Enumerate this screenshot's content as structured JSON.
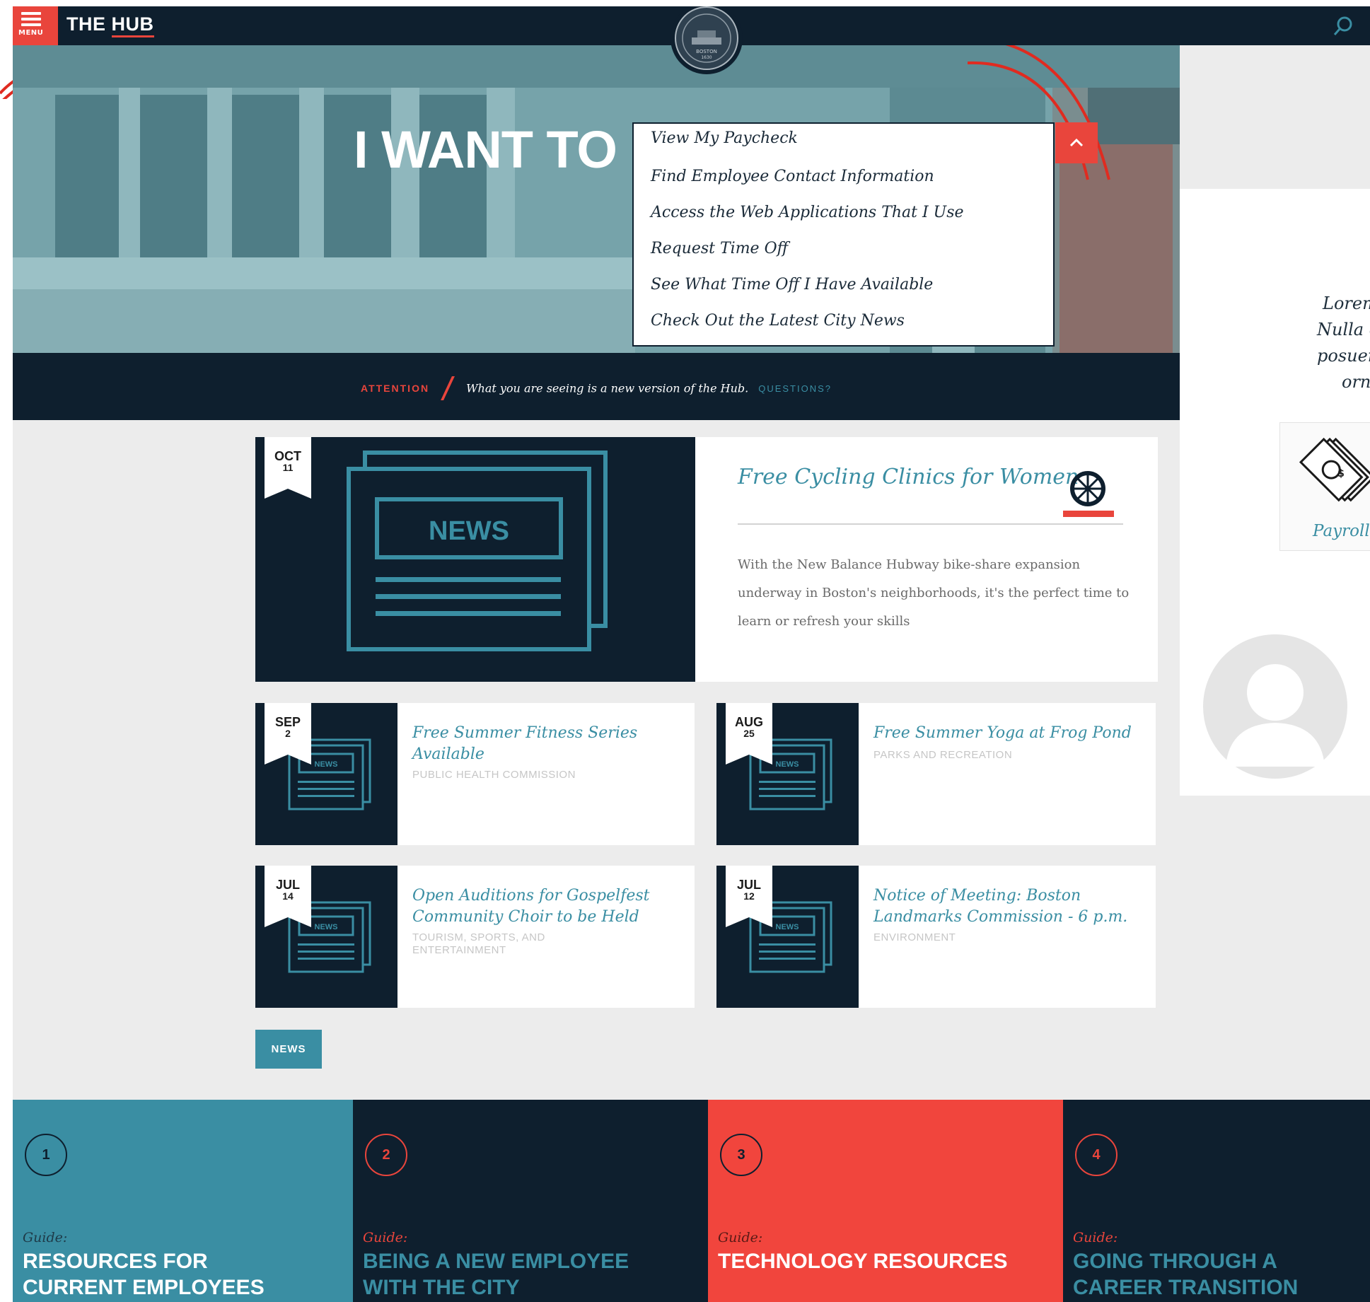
{
  "header": {
    "menu_label": "MENU",
    "site_title_a": "THE ",
    "site_title_b": "HUB",
    "seal_line1": "BOSTON",
    "seal_line2": "1630"
  },
  "hero": {
    "heading": "I WANT TO",
    "options": [
      "View My Paycheck",
      "Find Employee Contact Information",
      "Access the Web Applications That I Use",
      "Request Time Off",
      "See What Time Off I Have Available",
      "Check Out the Latest City News"
    ]
  },
  "attention": {
    "label": "ATTENTION",
    "message": "What you are seeing is a new version of the Hub.",
    "link": "QUESTIONS?"
  },
  "featured": {
    "month": "OCT",
    "day": "11",
    "image_label": "NEWS",
    "title": "Free Cycling Clinics for Women",
    "body": "With the New Balance Hubway bike-share expansion underway in Boston's neighborhoods, it's the perfect time to learn or refresh your skills"
  },
  "cards": [
    {
      "month": "SEP",
      "day": "2",
      "image_label": "NEWS",
      "title": "Free Summer Fitness Series Available",
      "category": "PUBLIC HEALTH COMMISSION"
    },
    {
      "month": "AUG",
      "day": "25",
      "image_label": "NEWS",
      "title": "Free Summer Yoga at Frog Pond",
      "category": "PARKS AND RECREATION"
    },
    {
      "month": "JUL",
      "day": "14",
      "image_label": "NEWS",
      "title": "Open Auditions for Gospelfest Community Choir to be Held",
      "category": "TOURISM, SPORTS, AND ENTERTAINMENT"
    },
    {
      "month": "JUL",
      "day": "12",
      "image_label": "NEWS",
      "title": "Notice of Meeting: Boston Landmarks Commission - 6 p.m.",
      "category": "ENVIRONMENT"
    }
  ],
  "news_button": "NEWS",
  "right_panel": {
    "text_lines": [
      "Lorem",
      "Nulla e",
      "posuer",
      "orn"
    ],
    "card_label": "Payroll"
  },
  "guides": [
    {
      "number": "1",
      "prefix": "Guide:",
      "title_line1": "RESOURCES FOR",
      "title_line2": "CURRENT EMPLOYEES",
      "bg": "#3a8ea3",
      "prefix_color": "#1e3a48",
      "title_color": "#ffffff",
      "circle_color": "#0e1f2e"
    },
    {
      "number": "2",
      "prefix": "Guide:",
      "title_line1": "BEING A NEW EMPLOYEE",
      "title_line2": "WITH THE CITY",
      "bg": "#0e1f2e",
      "prefix_color": "#e9453c",
      "title_color": "#3a8ea3",
      "circle_color": "#e9453c"
    },
    {
      "number": "3",
      "prefix": "Guide:",
      "title_line1": "TECHNOLOGY RESOURCES",
      "title_line2": "",
      "bg": "#f1453d",
      "prefix_color": "#5a1a16",
      "title_color": "#ffffff",
      "circle_color": "#0e1f2e"
    },
    {
      "number": "4",
      "prefix": "Guide:",
      "title_line1": "GOING THROUGH A",
      "title_line2": "CAREER TRANSITION",
      "bg": "#0e1f2e",
      "prefix_color": "#e9453c",
      "title_color": "#3a8ea3",
      "circle_color": "#e9453c"
    }
  ],
  "colors": {
    "navy": "#0e1f2e",
    "teal": "#3a8ea3",
    "red": "#e9453c",
    "page_bg": "#ececec"
  }
}
